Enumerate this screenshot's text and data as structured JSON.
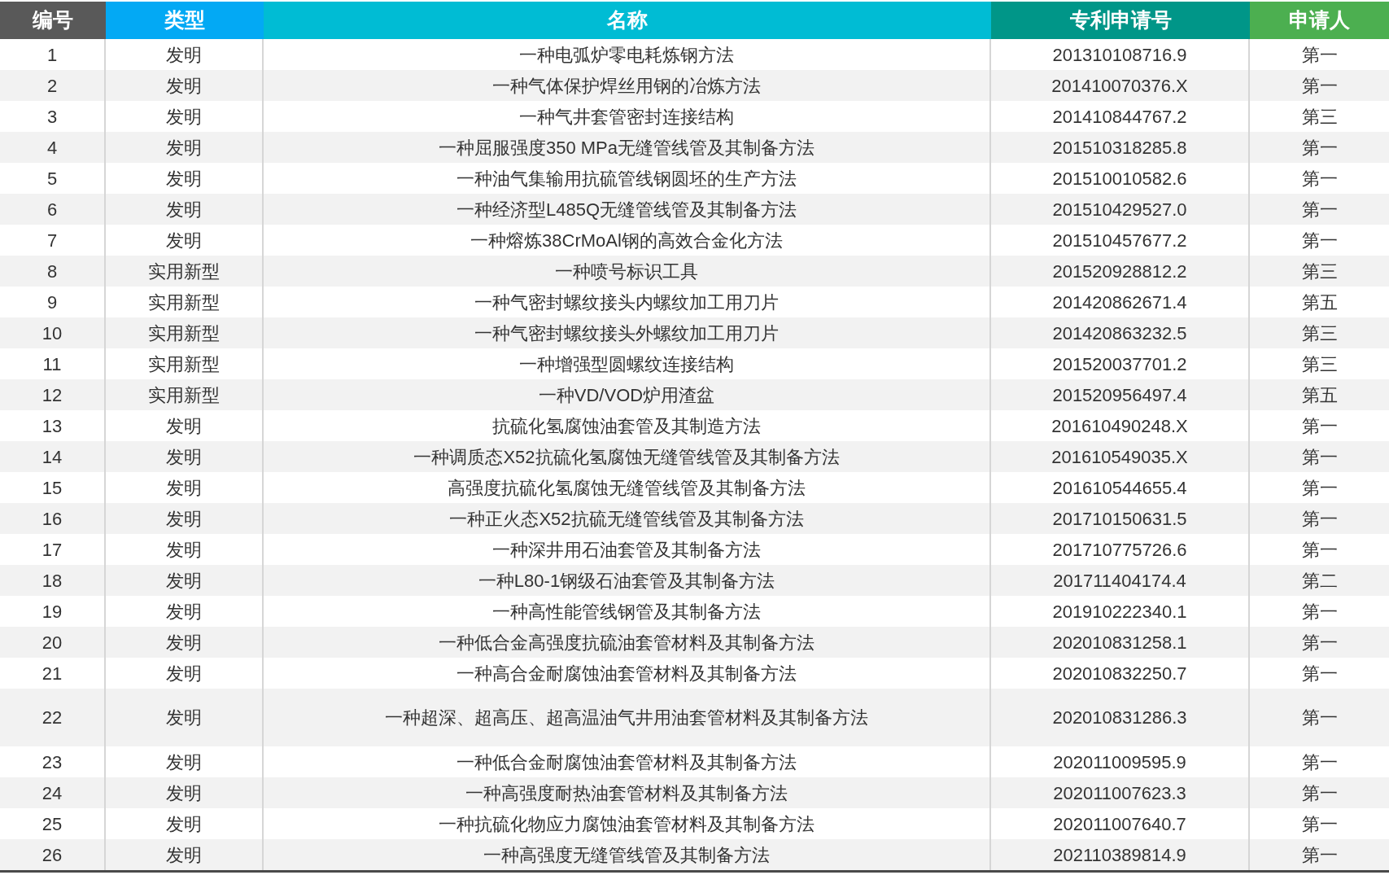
{
  "table": {
    "columns": [
      "编号",
      "类型",
      "名称",
      "专利申请号",
      "申请人"
    ],
    "rows": [
      [
        "1",
        "发明",
        "一种电弧炉零电耗炼钢方法",
        "201310108716.9",
        "第一"
      ],
      [
        "2",
        "发明",
        "一种气体保护焊丝用钢的冶炼方法",
        "201410070376.X",
        "第一"
      ],
      [
        "3",
        "发明",
        "一种气井套管密封连接结构",
        "201410844767.2",
        "第三"
      ],
      [
        "4",
        "发明",
        "一种屈服强度350 MPa无缝管线管及其制备方法",
        "201510318285.8",
        "第一"
      ],
      [
        "5",
        "发明",
        "一种油气集输用抗硫管线钢圆坯的生产方法",
        "201510010582.6",
        "第一"
      ],
      [
        "6",
        "发明",
        "一种经济型L485Q无缝管线管及其制备方法",
        "201510429527.0",
        "第一"
      ],
      [
        "7",
        "发明",
        "一种熔炼38CrMoAl钢的高效合金化方法",
        "201510457677.2",
        "第一"
      ],
      [
        "8",
        "实用新型",
        "一种喷号标识工具",
        "201520928812.2",
        "第三"
      ],
      [
        "9",
        "实用新型",
        "一种气密封螺纹接头内螺纹加工用刀片",
        "201420862671.4",
        "第五"
      ],
      [
        "10",
        "实用新型",
        "一种气密封螺纹接头外螺纹加工用刀片",
        "201420863232.5",
        "第三"
      ],
      [
        "11",
        "实用新型",
        "一种增强型圆螺纹连接结构",
        "201520037701.2",
        "第三"
      ],
      [
        "12",
        "实用新型",
        "一种VD/VOD炉用渣盆",
        "201520956497.4",
        "第五"
      ],
      [
        "13",
        "发明",
        "抗硫化氢腐蚀油套管及其制造方法",
        "201610490248.X",
        "第一"
      ],
      [
        "14",
        "发明",
        "一种调质态X52抗硫化氢腐蚀无缝管线管及其制备方法",
        "201610549035.X",
        "第一"
      ],
      [
        "15",
        "发明",
        "高强度抗硫化氢腐蚀无缝管线管及其制备方法",
        "201610544655.4",
        "第一"
      ],
      [
        "16",
        "发明",
        "一种正火态X52抗硫无缝管线管及其制备方法",
        "201710150631.5",
        "第一"
      ],
      [
        "17",
        "发明",
        "一种深井用石油套管及其制备方法",
        "201710775726.6",
        "第一"
      ],
      [
        "18",
        "发明",
        "一种L80-1钢级石油套管及其制备方法",
        "201711404174.4",
        "第二"
      ],
      [
        "19",
        "发明",
        "一种高性能管线钢管及其制备方法",
        "201910222340.1",
        "第一"
      ],
      [
        "20",
        "发明",
        "一种低合金高强度抗硫油套管材料及其制备方法",
        "202010831258.1",
        "第一"
      ],
      [
        "21",
        "发明",
        "一种高合金耐腐蚀油套管材料及其制备方法",
        "202010832250.7",
        "第一"
      ],
      [
        "22",
        "发明",
        "一种超深、超高压、超高温油气井用油套管材料及其制备方法",
        "202010831286.3",
        "第一"
      ],
      [
        "23",
        "发明",
        "一种低合金耐腐蚀油套管材料及其制备方法",
        "202011009595.9",
        "第一"
      ],
      [
        "24",
        "发明",
        "一种高强度耐热油套管材料及其制备方法",
        "202011007623.3",
        "第一"
      ],
      [
        "25",
        "发明",
        "一种抗硫化物应力腐蚀油套管材料及其制备方法",
        "202011007640.7",
        "第一"
      ],
      [
        "26",
        "发明",
        "一种高强度无缝管线管及其制备方法",
        "202110389814.9",
        "第一"
      ]
    ]
  }
}
